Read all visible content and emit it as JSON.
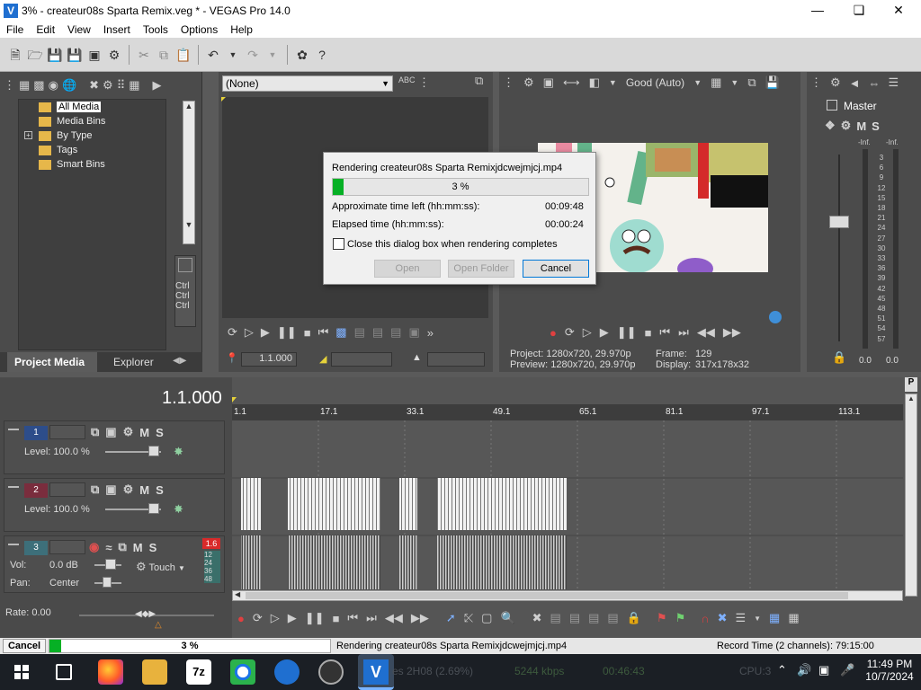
{
  "window": {
    "title": "3% - createur08s Sparta Remix.veg * - VEGAS Pro 14.0",
    "app_icon_letter": "V"
  },
  "menu": [
    "File",
    "Edit",
    "View",
    "Insert",
    "Tools",
    "Options",
    "Help"
  ],
  "project_media": {
    "tree": [
      "All Media",
      "Media Bins",
      "By Type",
      "Tags",
      "Smart Bins"
    ],
    "tabs": [
      "Project Media",
      "Explorer"
    ],
    "ctrl_labels": [
      "Ctrl",
      "Ctrl",
      "Ctrl"
    ]
  },
  "trimmer": {
    "selected": "(None)",
    "position": "1.1.000"
  },
  "preview": {
    "quality": "Good (Auto)",
    "project_label": "Project:",
    "project_value": "1280x720, 29.970p",
    "preview_label": "Preview:",
    "preview_value": "1280x720, 29.970p",
    "frame_label": "Frame:",
    "frame_value": "129",
    "display_label": "Display:",
    "display_value": "317x178x32"
  },
  "master": {
    "label": "Master",
    "m": "M",
    "s": "S",
    "inf_left": "-Inf.",
    "inf_right": "-Inf.",
    "scale": [
      "3",
      "6",
      "9",
      "12",
      "15",
      "18",
      "21",
      "24",
      "27",
      "30",
      "33",
      "36",
      "39",
      "42",
      "45",
      "48",
      "51",
      "54",
      "57"
    ],
    "value_left": "0.0",
    "value_right": "0.0"
  },
  "timeline": {
    "cursor_time": "1.1.000",
    "ruler": [
      "1.1",
      "17.1",
      "33.1",
      "49.1",
      "65.1",
      "81.1",
      "97.1",
      "113.1"
    ],
    "tracks": [
      {
        "num": "1",
        "level_label": "Level:",
        "level_value": "100.0 %",
        "m": "M",
        "s": "S"
      },
      {
        "num": "2",
        "level_label": "Level:",
        "level_value": "100.0 %",
        "m": "M",
        "s": "S"
      },
      {
        "num": "3",
        "vol_label": "Vol:",
        "vol_value": "0.0 dB",
        "pan_label": "Pan:",
        "pan_value": "Center",
        "touch": "Touch",
        "m": "M",
        "s": "S",
        "peak": "1.6",
        "meter": [
          "12",
          "24",
          "36",
          "48"
        ]
      }
    ],
    "rate": "Rate: 0.00",
    "p_button": "P"
  },
  "render_dialog": {
    "title": "Rendering createur08s Sparta Remixjdcwejmjcj.mp4",
    "progress_text": "3 %",
    "progress": 0.03,
    "time_left_label": "Approximate time left (hh:mm:ss):",
    "time_left_value": "00:09:48",
    "elapsed_label": "Elapsed time (hh:mm:ss):",
    "elapsed_value": "00:00:24",
    "close_checkbox_label": "Close this dialog box when rendering completes",
    "open_label": "Open",
    "open_folder_label": "Open Folder",
    "cancel_label": "Cancel"
  },
  "statusbar": {
    "cancel_label": "Cancel",
    "progress_text": "3 %",
    "progress": 0.03,
    "message": "Rendering createur08s Sparta Remixjdcwejmjcj.mp4",
    "record_time": "Record Time (2 channels): 79:15:00"
  },
  "taskbar": {
    "bg_text_1": "es 2H08 (2.69%)",
    "bg_text_2": "5244 kbps",
    "bg_text_3": "00:46:43",
    "bg_text_4": "CPU:3",
    "time": "11:49 PM",
    "date": "10/7/2024",
    "sevenzip": "7z"
  }
}
